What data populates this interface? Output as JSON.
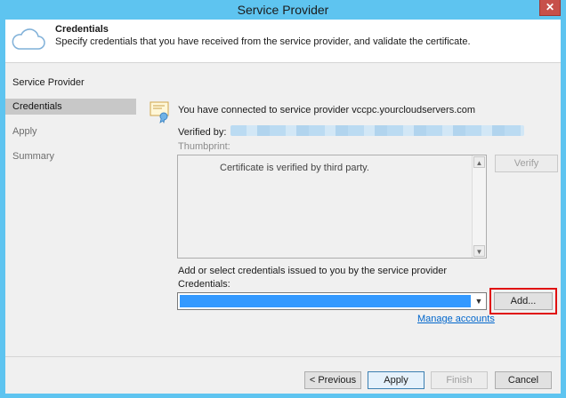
{
  "window": {
    "title": "Service Provider",
    "close_glyph": "✕"
  },
  "header": {
    "title": "Credentials",
    "subtitle": "Specify credentials that you have received from the service provider, and validate the certificate.",
    "icon": "cloud-icon"
  },
  "nav": {
    "items": [
      {
        "label": "Service Provider",
        "state": "normal"
      },
      {
        "label": "Credentials",
        "state": "active"
      },
      {
        "label": "Apply",
        "state": "dim"
      },
      {
        "label": "Summary",
        "state": "dim"
      }
    ]
  },
  "main": {
    "connected_text": "You have connected to service provider vccpc.yourcloudservers.com",
    "verified_by_label": "Verified by:",
    "verified_by_value": "",
    "thumbprint_label": "Thumbprint:",
    "certificate_text": "Certificate is verified by third party.",
    "verify_label": "Verify",
    "add_select_label": "Add or select credentials issued to you by the service provider",
    "credentials_label": "Credentials:",
    "add_label": "Add...",
    "manage_accounts_label": "Manage accounts",
    "icons": {
      "certificate": "certificate-icon",
      "scroll_up": "▲",
      "scroll_down": "▼",
      "combo_arrow": "▼"
    }
  },
  "footer": {
    "previous_label": "< Previous",
    "apply_label": "Apply",
    "finish_label": "Finish",
    "cancel_label": "Cancel"
  },
  "colors": {
    "title_bar": "#5ec4f0",
    "selection": "#3399ff",
    "highlight_border": "#e01010",
    "link": "#0066cc"
  }
}
